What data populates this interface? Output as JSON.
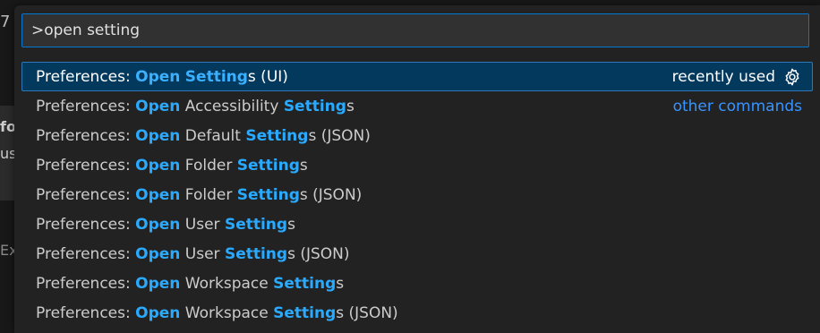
{
  "background": {
    "fragment_top": "7",
    "fragment_fo": "fo",
    "fragment_us": "us",
    "fragment_ex": "Ex"
  },
  "palette": {
    "input_value": ">open setting",
    "items": [
      {
        "prefix": "Preferences: ",
        "parts": [
          {
            "t": "Open",
            "h": true
          },
          {
            "t": " ",
            "h": false
          },
          {
            "t": "Setting",
            "h": true
          },
          {
            "t": "s (UI)",
            "h": false
          }
        ],
        "selected": true,
        "right_label": "recently used",
        "right_icon": "gear-icon"
      },
      {
        "prefix": "Preferences: ",
        "parts": [
          {
            "t": "Open",
            "h": true
          },
          {
            "t": " Accessibility ",
            "h": false
          },
          {
            "t": "Setting",
            "h": true
          },
          {
            "t": "s",
            "h": false
          }
        ],
        "selected": false,
        "right_label": "other commands"
      },
      {
        "prefix": "Preferences: ",
        "parts": [
          {
            "t": "Open",
            "h": true
          },
          {
            "t": " Default ",
            "h": false
          },
          {
            "t": "Setting",
            "h": true
          },
          {
            "t": "s (JSON)",
            "h": false
          }
        ],
        "selected": false
      },
      {
        "prefix": "Preferences: ",
        "parts": [
          {
            "t": "Open",
            "h": true
          },
          {
            "t": " Folder ",
            "h": false
          },
          {
            "t": "Setting",
            "h": true
          },
          {
            "t": "s",
            "h": false
          }
        ],
        "selected": false
      },
      {
        "prefix": "Preferences: ",
        "parts": [
          {
            "t": "Open",
            "h": true
          },
          {
            "t": " Folder ",
            "h": false
          },
          {
            "t": "Setting",
            "h": true
          },
          {
            "t": "s (JSON)",
            "h": false
          }
        ],
        "selected": false
      },
      {
        "prefix": "Preferences: ",
        "parts": [
          {
            "t": "Open",
            "h": true
          },
          {
            "t": " User ",
            "h": false
          },
          {
            "t": "Setting",
            "h": true
          },
          {
            "t": "s",
            "h": false
          }
        ],
        "selected": false
      },
      {
        "prefix": "Preferences: ",
        "parts": [
          {
            "t": "Open",
            "h": true
          },
          {
            "t": " User ",
            "h": false
          },
          {
            "t": "Setting",
            "h": true
          },
          {
            "t": "s (JSON)",
            "h": false
          }
        ],
        "selected": false
      },
      {
        "prefix": "Preferences: ",
        "parts": [
          {
            "t": "Open",
            "h": true
          },
          {
            "t": " Workspace ",
            "h": false
          },
          {
            "t": "Setting",
            "h": true
          },
          {
            "t": "s",
            "h": false
          }
        ],
        "selected": false
      },
      {
        "prefix": "Preferences: ",
        "parts": [
          {
            "t": "Open",
            "h": true
          },
          {
            "t": " Workspace ",
            "h": false
          },
          {
            "t": "Setting",
            "h": true
          },
          {
            "t": "s (JSON)",
            "h": false
          }
        ],
        "selected": false
      }
    ]
  },
  "colors": {
    "accent": "#0078d4",
    "highlight": "#2aaaff",
    "selected_bg": "#04395e",
    "link": "#3794ff"
  }
}
